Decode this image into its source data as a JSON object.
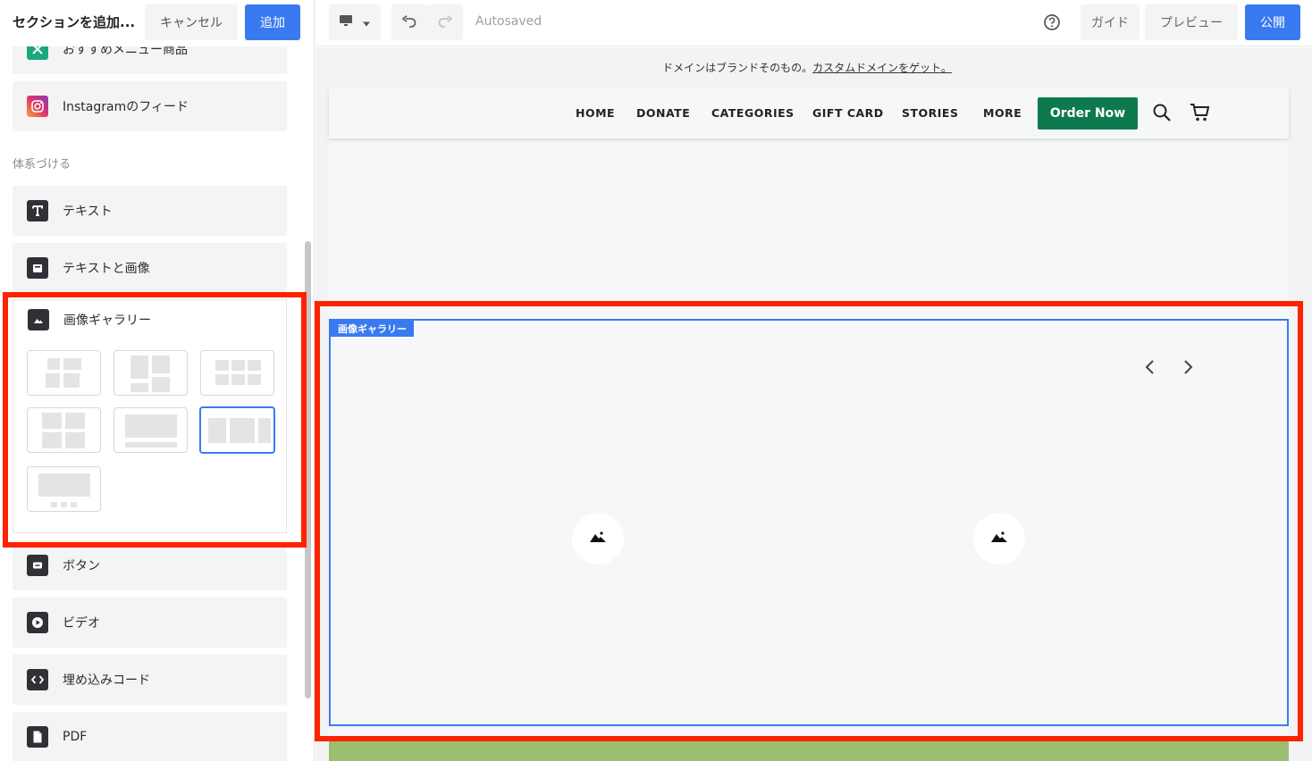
{
  "panel": {
    "title": "セクションを追加...",
    "cancel_label": "キャンセル",
    "add_label": "追加",
    "items_top": [
      {
        "label": "おすすめメニュー商品",
        "icon": "recommended-menu-icon"
      },
      {
        "label": "Instagramのフィード",
        "icon": "instagram-icon"
      }
    ],
    "section_heading": "体系づける",
    "items_org": [
      {
        "label": "テキスト",
        "icon": "text-icon"
      },
      {
        "label": "テキストと画像",
        "icon": "text-image-icon"
      }
    ],
    "gallery": {
      "label": "画像ギャラリー",
      "icon": "image-gallery-icon",
      "selected_layout": 6
    },
    "items_bottom": [
      {
        "label": "ボタン",
        "icon": "button-icon"
      },
      {
        "label": "ビデオ",
        "icon": "video-icon"
      },
      {
        "label": "埋め込みコード",
        "icon": "embed-code-icon"
      },
      {
        "label": "PDF",
        "icon": "pdf-icon"
      }
    ]
  },
  "toolbar": {
    "autosaved": "Autosaved",
    "guide_label": "ガイド",
    "preview_label": "プレビュー",
    "publish_label": "公開"
  },
  "canvas": {
    "domain_text": "ドメインはブランドそのもの。",
    "domain_link": "カスタムドメインをゲット。",
    "nav_links": [
      "HOME",
      "DONATE",
      "CATEGORIES",
      "GIFT CARD",
      "STORIES",
      "MORE"
    ],
    "order_button": "Order Now",
    "gallery_tag": "画像ギャラリー"
  },
  "colors": {
    "accent": "#3a7af0",
    "order_button": "#0d7a4e",
    "highlight": "#ff2200",
    "footer_strip": "#9bbd6f"
  }
}
